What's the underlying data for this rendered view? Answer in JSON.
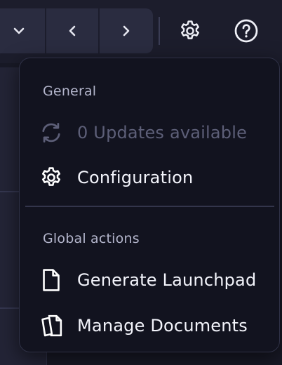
{
  "toolbar": {
    "dropdown_icon": "chevron-down-icon",
    "prev_icon": "chevron-left-icon",
    "next_icon": "chevron-right-icon",
    "settings_icon": "gear-icon",
    "help_icon": "question-circle-icon"
  },
  "menu": {
    "sections": [
      {
        "heading": "General",
        "items": [
          {
            "label": "0 Updates available",
            "icon": "sync-icon",
            "disabled": true
          },
          {
            "label": "Configuration",
            "icon": "gear-icon",
            "disabled": false
          }
        ]
      },
      {
        "heading": "Global actions",
        "items": [
          {
            "label": "Generate Launchpad",
            "icon": "document-icon",
            "disabled": false
          },
          {
            "label": "Manage Documents",
            "icon": "documents-icon",
            "disabled": false
          }
        ]
      }
    ]
  },
  "colors": {
    "menu_background": "#12131f",
    "text_primary": "#f3f4fb",
    "text_disabled": "#5d5f78",
    "heading": "#b3b5cb"
  }
}
